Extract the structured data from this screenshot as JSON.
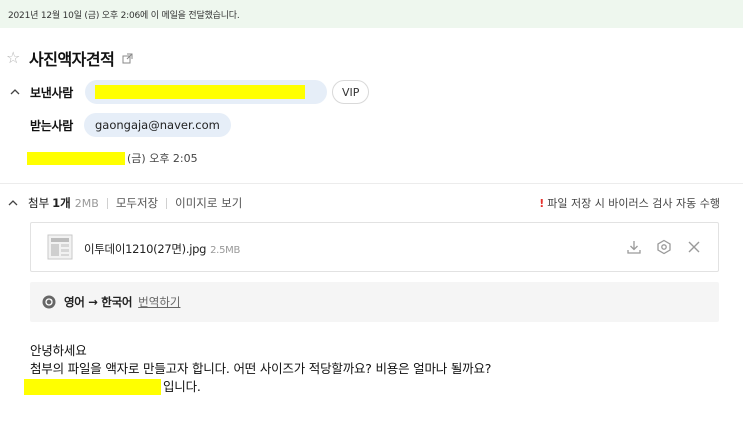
{
  "notice": {
    "text": "2021년 12월 10일 (금) 오후 2:06에 이 메일을 전달했습니다."
  },
  "mail": {
    "subject": "사진액자견적",
    "sender_label": "보낸사람",
    "sender_badge": "VIP",
    "recipient_label": "받는사람",
    "recipient_email": "gaongaja@naver.com",
    "date_suffix": "(금) 오후 2:05"
  },
  "attachments": {
    "label": "첨부",
    "count": "1개",
    "size": "2MB",
    "save_all": "모두저장",
    "view_images": "이미지로 보기",
    "virus_notice": "파일 저장 시 바이러스 검사 자동 수행",
    "files": [
      {
        "name": "이투데이1210(27면).jpg",
        "size": "2.5MB"
      }
    ]
  },
  "translate": {
    "languages": "영어 → 한국어",
    "link": "번역하기"
  },
  "body": {
    "line1": "안녕하세요",
    "line2": "첨부의 파일을 액자로 만들고자 합니다. 어떤 사이즈가 적당할까요? 비용은 얼마나 될까요?",
    "line3_suffix": "입니다."
  },
  "colors": {
    "notice_bg": "#eef7ee",
    "pill_bg": "#e6eef8",
    "redaction": "#ffff00",
    "warning": "#e5322d"
  }
}
